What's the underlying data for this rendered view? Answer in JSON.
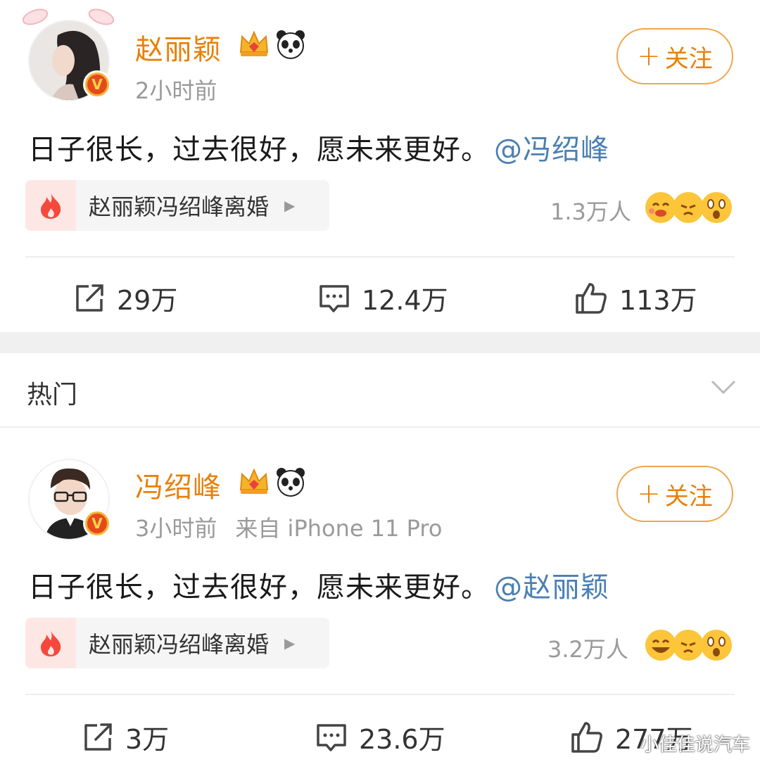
{
  "posts": [
    {
      "author": "赵丽颖",
      "time": "2小时前",
      "source": "",
      "follow_label": "关注",
      "text": "日子很长，过去很好，愿未来更好。",
      "mention": "@冯绍峰",
      "topic": "赵丽颖冯绍峰离婚",
      "reactions": "1.3万人",
      "reposts": "29万",
      "comments": "12.4万",
      "likes": "113万"
    },
    {
      "author": "冯绍峰",
      "time": "3小时前",
      "source": "来自 iPhone 11 Pro",
      "follow_label": "关注",
      "text": "日子很长，过去很好，愿未来更好。",
      "mention": "@赵丽颖",
      "topic": "赵丽颖冯绍峰离婚",
      "reactions": "3.2万人",
      "reposts": "3万",
      "comments": "23.6万",
      "likes": "277万"
    }
  ],
  "section": {
    "title": "热门"
  },
  "watermark": "小佳佳说汽车",
  "colors": {
    "name": "#e8800c",
    "mention": "#4a7fb3",
    "meta": "#9a9a9a",
    "follow_border": "#f0a64a"
  }
}
